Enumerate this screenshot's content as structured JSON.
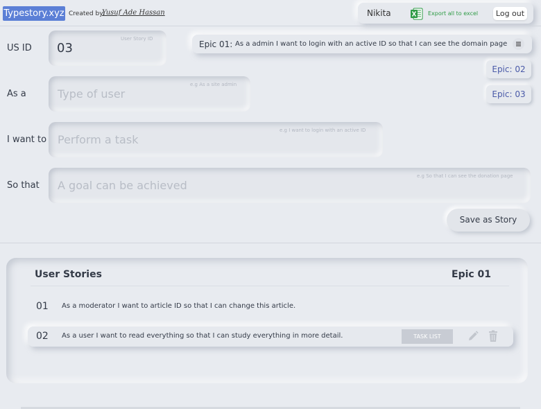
{
  "header": {
    "logo": "Typestory.xyz",
    "created_by_label": "Created by:",
    "author": "Yusuf Ade Hassan",
    "username": "Nikita",
    "export_label": "Export all to excel",
    "logout_label": "Log out",
    "excel_icon": "excel-icon"
  },
  "form": {
    "usid": {
      "label": "US ID",
      "value": "03",
      "hint": "User Story ID"
    },
    "as_a": {
      "label": "As a",
      "placeholder": "Type of user",
      "hint": "e.g As a site admin"
    },
    "i_want_to": {
      "label": "I want to",
      "placeholder": "Perform a task",
      "hint": "e.g I want to login with an active ID"
    },
    "so_that": {
      "label": "So that",
      "placeholder": "A goal can be achieved",
      "hint": "e.g So that I can see the donation page"
    },
    "save_label": "Save as Story"
  },
  "epics": {
    "current": {
      "title": "Epic 01:",
      "text": "As a admin I want to login with an active ID so that I can see the domain page",
      "menu_icon": "menu-icon"
    },
    "buttons": [
      "Epic: 02",
      "Epic: 03"
    ]
  },
  "stories": {
    "title": "User Stories",
    "epic": "Epic 01",
    "rows": [
      {
        "num": "01",
        "text": "As a moderator  I want to article ID  so that I can change this article."
      },
      {
        "num": "02",
        "text": "As a user  I want to read everything  so that I can study everything in more detail.",
        "task_label": "TASK LIST",
        "edit_icon": "pencil-icon",
        "delete_icon": "trash-icon"
      }
    ]
  },
  "colors": {
    "accent": "#5b7fd6",
    "excel": "#2e9b45",
    "epic_text": "#4a5aa8"
  }
}
